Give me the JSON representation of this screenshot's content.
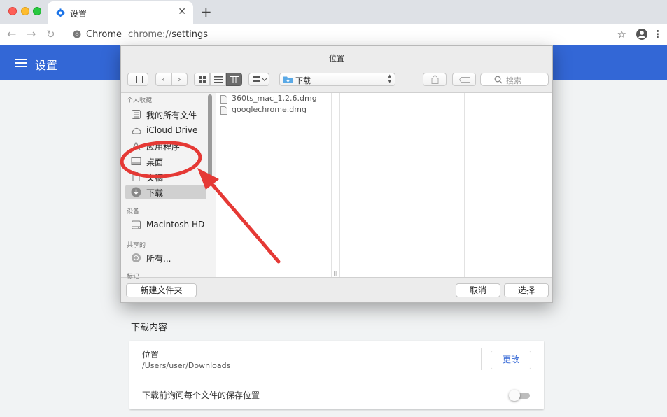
{
  "browser": {
    "tab_title": "设置",
    "new_tab": "+",
    "tab_close": "✕",
    "omnibox": {
      "origin_label": "Chrome",
      "url_scheme": "chrome://",
      "url_host": "settings"
    },
    "nav": {
      "back": "←",
      "forward": "→",
      "reload": "↻",
      "star": "☆",
      "menu": "⋮"
    }
  },
  "settings": {
    "header_title": "设置",
    "downloads_section_title": "下载内容",
    "location_label": "位置",
    "location_path": "/Users/user/Downloads",
    "change_button": "更改",
    "ask_label": "下载前询问每个文件的保存位置",
    "ask_enabled": false
  },
  "dialog": {
    "title": "位置",
    "current_folder": "下载",
    "search_placeholder": "搜索",
    "sidebar": {
      "favorites_header": "个人收藏",
      "favorites": [
        {
          "label": "我的所有文件",
          "icon": "all-files-icon"
        },
        {
          "label": "iCloud Drive",
          "icon": "cloud-icon"
        },
        {
          "label": "应用程序",
          "icon": "applications-icon"
        },
        {
          "label": "桌面",
          "icon": "desktop-icon"
        },
        {
          "label": "文稿",
          "icon": "documents-icon"
        },
        {
          "label": "下载",
          "icon": "downloads-icon",
          "selected": true
        }
      ],
      "devices_header": "设备",
      "devices": [
        {
          "label": "Macintosh HD",
          "icon": "disk-icon"
        }
      ],
      "shared_header": "共享的",
      "shared": [
        {
          "label": "所有...",
          "icon": "network-icon"
        }
      ],
      "tags_header": "标记"
    },
    "files": [
      "360ts_mac_1.2.6.dmg",
      "googlechrome.dmg"
    ],
    "buttons": {
      "new_folder": "新建文件夹",
      "cancel": "取消",
      "choose": "选择"
    }
  },
  "colors": {
    "settings_blue": "#3367d6",
    "annotation_red": "#e53935",
    "tab_strip": "#dee1e6"
  }
}
